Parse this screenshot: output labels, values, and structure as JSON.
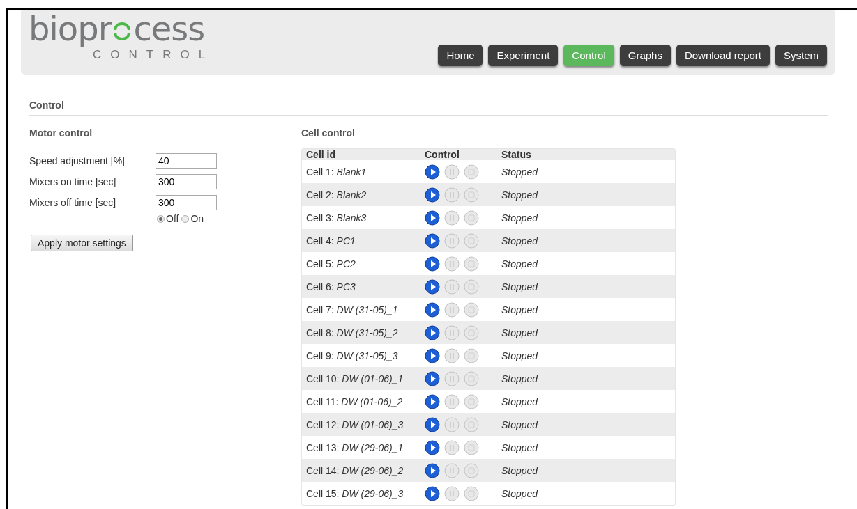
{
  "logo": {
    "word_start": "biopr",
    "word_end": "cess",
    "subtitle": "CONTROL"
  },
  "nav": [
    {
      "label": "Home",
      "selected": false
    },
    {
      "label": "Experiment",
      "selected": false
    },
    {
      "label": "Control",
      "selected": true
    },
    {
      "label": "Graphs",
      "selected": false
    },
    {
      "label": "Download report",
      "selected": false
    },
    {
      "label": "System",
      "selected": false
    }
  ],
  "page_title": "Control",
  "motor_control": {
    "title": "Motor control",
    "fields": [
      {
        "label": "Speed adjustment [%]",
        "value": "40"
      },
      {
        "label": "Mixers on time [sec]",
        "value": "300"
      },
      {
        "label": "Mixers off time [sec]",
        "value": "300"
      }
    ],
    "mode_options": [
      {
        "label": "Off",
        "selected": true
      },
      {
        "label": "On",
        "selected": false
      }
    ],
    "apply_button": "Apply motor settings"
  },
  "cell_control": {
    "title": "Cell control",
    "columns": [
      "Cell id",
      "Control",
      "Status"
    ],
    "rows": [
      {
        "cell": "Cell 1: *Blank1*",
        "status": "Stopped",
        "play_disabled": false,
        "pause_disabled": true,
        "stop_disabled": true
      },
      {
        "cell": "Cell 2: *Blank2*",
        "status": "Stopped",
        "play_disabled": false,
        "pause_disabled": true,
        "stop_disabled": true
      },
      {
        "cell": "Cell 3: *Blank3*",
        "status": "Stopped",
        "play_disabled": false,
        "pause_disabled": true,
        "stop_disabled": true
      },
      {
        "cell": "Cell 4: *PC1*",
        "status": "Stopped",
        "play_disabled": false,
        "pause_disabled": true,
        "stop_disabled": true
      },
      {
        "cell": "Cell 5: *PC2*",
        "status": "Stopped",
        "play_disabled": false,
        "pause_disabled": true,
        "stop_disabled": true
      },
      {
        "cell": "Cell 6: *PC3*",
        "status": "Stopped",
        "play_disabled": false,
        "pause_disabled": true,
        "stop_disabled": true
      },
      {
        "cell": "Cell 7: *DW (31-05)_1*",
        "status": "Stopped",
        "play_disabled": false,
        "pause_disabled": true,
        "stop_disabled": true
      },
      {
        "cell": "Cell 8: *DW (31-05)_2*",
        "status": "Stopped",
        "play_disabled": false,
        "pause_disabled": true,
        "stop_disabled": true
      },
      {
        "cell": "Cell 9: *DW (31-05)_3*",
        "status": "Stopped",
        "play_disabled": false,
        "pause_disabled": true,
        "stop_disabled": true
      },
      {
        "cell": "Cell 10: *DW (01-06)_1*",
        "status": "Stopped",
        "play_disabled": false,
        "pause_disabled": true,
        "stop_disabled": true
      },
      {
        "cell": "Cell 11: *DW (01-06)_2*",
        "status": "Stopped",
        "play_disabled": false,
        "pause_disabled": true,
        "stop_disabled": true
      },
      {
        "cell": "Cell 12: *DW (01-06)_3*",
        "status": "Stopped",
        "play_disabled": false,
        "pause_disabled": true,
        "stop_disabled": true
      },
      {
        "cell": "Cell 13: *DW (29-06)_1*",
        "status": "Stopped",
        "play_disabled": false,
        "pause_disabled": true,
        "stop_disabled": true
      },
      {
        "cell": "Cell 14: *DW (29-06)_2*",
        "status": "Stopped",
        "play_disabled": false,
        "pause_disabled": true,
        "stop_disabled": true
      },
      {
        "cell": "Cell 15: *DW (29-06)_3*",
        "status": "Stopped",
        "play_disabled": false,
        "pause_disabled": true,
        "stop_disabled": true
      }
    ]
  }
}
